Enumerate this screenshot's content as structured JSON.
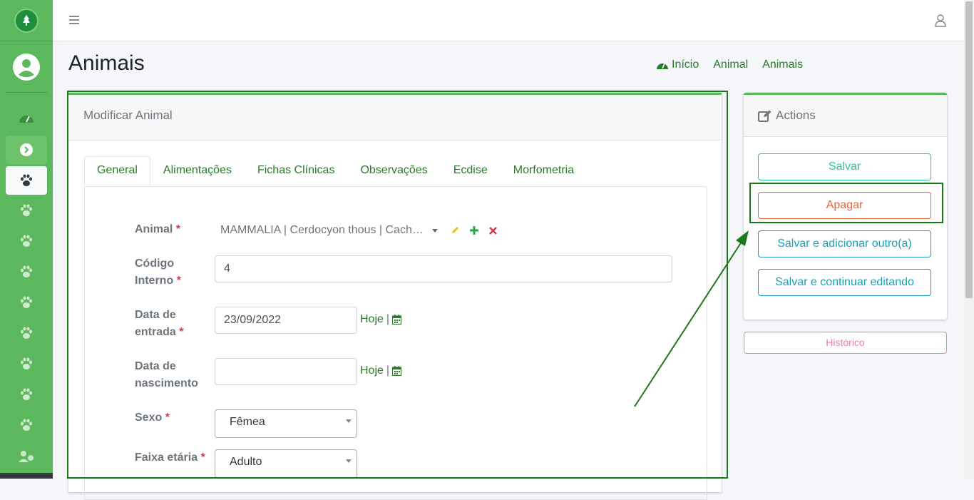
{
  "page": {
    "title": "Animais"
  },
  "breadcrumb": {
    "home": "Início",
    "animal": "Animal",
    "animals": "Animais"
  },
  "form": {
    "header": "Modificar Animal",
    "tabs": [
      "General",
      "Alimentações",
      "Fichas Clínicas",
      "Observações",
      "Ecdise",
      "Morfometria"
    ],
    "fields": {
      "animal": {
        "label": "Animal",
        "value": "MAMMALIA | Cerdocyon thous | Cach…"
      },
      "codigo": {
        "label_line1": "Código",
        "label_line2": "Interno",
        "value": "4"
      },
      "entrada": {
        "label_line1": "Data de",
        "label_line2": "entrada",
        "value": "23/09/2022",
        "today": "Hoje"
      },
      "nascimento": {
        "label_line1": "Data de",
        "label_line2": "nascimento",
        "value": "",
        "today": "Hoje"
      },
      "sexo": {
        "label": "Sexo",
        "value": "Fêmea"
      },
      "faixa": {
        "label": "Faixa etária",
        "value": "Adulto"
      }
    },
    "required_mark": "*",
    "separator": "|"
  },
  "actions": {
    "header": "Actions",
    "save": "Salvar",
    "delete": "Apagar",
    "save_add": "Salvar e adicionar outro(a)",
    "save_continue": "Salvar e continuar editando",
    "history": "Histórico"
  },
  "colors": {
    "sidebar": "#5cb85c",
    "link": "#2a7a2a",
    "annotation": "#1a7a1a"
  },
  "icons": {
    "menu": "hamburger-icon",
    "user": "user-icon",
    "dashboard": "gauge-icon",
    "paw": "paw-icon",
    "calendar": "calendar-icon"
  }
}
